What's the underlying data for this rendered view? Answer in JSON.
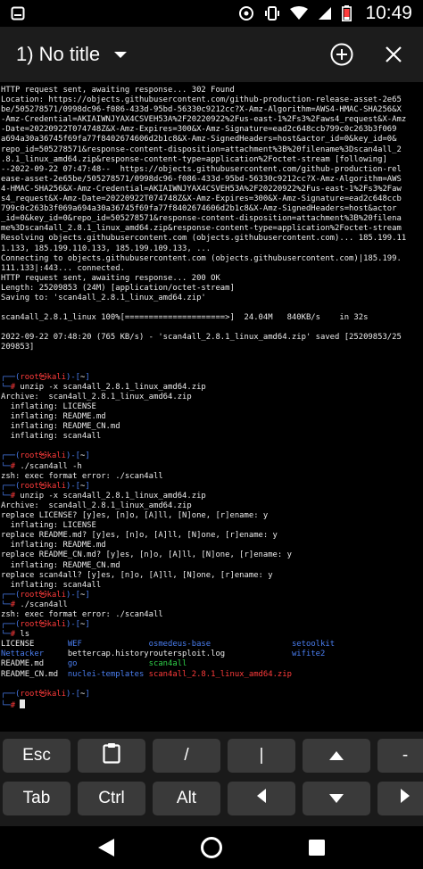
{
  "statusbar": {
    "time": "10:49",
    "icons": [
      "notification-box-icon",
      "sync-icon",
      "vibrate-icon",
      "wifi-icon",
      "signal-icon",
      "battery-icon"
    ]
  },
  "actionbar": {
    "title": "1) No title",
    "icons": [
      "dropdown-icon",
      "add-session-icon",
      "close-icon"
    ]
  },
  "colors": {
    "prompt": "#ff3b3b",
    "path": "#4a7ef0",
    "success": "#2fd24a"
  },
  "terminal": {
    "output": [
      "HTTP request sent, awaiting response... 302 Found",
      "Location: https://objects.githubusercontent.com/github-production-release-asset-2e65",
      "be/505278571/0998dc96-f086-433d-95bd-56330c9212cc?X-Amz-Algorithm=AWS4-HMAC-SHA256&X",
      "-Amz-Credential=AKIAIWNJYAX4CSVEH53A%2F20220922%2Fus-east-1%2Fs3%2Faws4_request&X-Amz",
      "-Date=20220922T074748Z&X-Amz-Expires=300&X-Amz-Signature=ead2c648ccb799c0c263b3f069",
      "a694a30a36745f69fa77f8402674606d2b1c8&X-Amz-SignedHeaders=host&actor_id=0&key_id=0&",
      "repo_id=505278571&response-content-disposition=attachment%3B%20filename%3Dscan4all_2",
      ".8.1_linux_amd64.zip&response-content-type=application%2Foctet-stream [following]",
      "--2022-09-22 07:47:48--  https://objects.githubusercontent.com/github-production-rel",
      "ease-asset-2e65be/505278571/0998dc96-f086-433d-95bd-56330c9212cc?X-Amz-Algorithm=AWS",
      "4-HMAC-SHA256&X-Amz-Credential=AKIAIWNJYAX4CSVEH53A%2F20220922%2Fus-east-1%2Fs3%2Faw",
      "s4_request&X-Amz-Date=20220922T074748Z&X-Amz-Expires=300&X-Amz-Signature=ead2c648ccb",
      "799c0c263b3f069a694a30a36745f69fa77f8402674606d2b1c8&X-Amz-SignedHeaders=host&actor",
      "_id=0&key_id=0&repo_id=505278571&response-content-disposition=attachment%3B%20filena",
      "me%3Dscan4all_2.8.1_linux_amd64.zip&response-content-type=application%2Foctet-stream",
      "Resolving objects.githubusercontent.com (objects.githubusercontent.com)... 185.199.11",
      "1.133, 185.199.110.133, 185.199.109.133, ...",
      "Connecting to objects.githubusercontent.com (objects.githubusercontent.com)|185.199.",
      "111.133|:443... connected.",
      "HTTP request sent, awaiting response... 200 OK",
      "Length: 25209853 (24M) [application/octet-stream]",
      "Saving to: 'scan4all_2.8.1_linux_amd64.zip'",
      "",
      "scan4all_2.8.1_linux 100%[=====================>]  24.04M   840KB/s    in 32s",
      "",
      "2022-09-22 07:48:20 (765 KB/s) - 'scan4all_2.8.1_linux_amd64.zip' saved [25209853/25",
      "209853]",
      "",
      ""
    ],
    "prompt_user": "root㉿kali",
    "prompt_dir": "~",
    "blocks": [
      {
        "command": " unzip -x scan4all_2.8.1_linux_amd64.zip",
        "output": [
          "Archive:  scan4all_2.8.1_linux_amd64.zip",
          "  inflating: LICENSE",
          "  inflating: README.md",
          "  inflating: README_CN.md",
          "  inflating: scan4all",
          ""
        ]
      },
      {
        "command": " ./scan4all -h",
        "output": [
          "zsh: exec format error: ./scan4all"
        ]
      },
      {
        "command": " unzip -x scan4all_2.8.1_linux_amd64.zip",
        "output": [
          "Archive:  scan4all_2.8.1_linux_amd64.zip",
          "replace LICENSE? [y]es, [n]o, [A]ll, [N]one, [r]ename: y",
          "  inflating: LICENSE",
          "replace README.md? [y]es, [n]o, [A]ll, [N]one, [r]ename: y",
          "  inflating: README.md",
          "replace README_CN.md? [y]es, [n]o, [A]ll, [N]one, [r]ename: y",
          "  inflating: README_CN.md",
          "replace scan4all? [y]es, [n]o, [A]ll, [N]one, [r]ename: y",
          "  inflating: scan4all"
        ]
      },
      {
        "command": " ./scan4all",
        "output": [
          "zsh: exec format error: ./scan4all"
        ]
      },
      {
        "command": " ls",
        "output": []
      }
    ],
    "ls_listing": [
      [
        "LICENSE",
        "WEF",
        "osmedeus-base",
        "setoolkit"
      ],
      [
        "Nettacker",
        "bettercap.history",
        "routersploit.log",
        "wifite2"
      ],
      [
        "README.md",
        "go",
        "scan4all",
        ""
      ],
      [
        "README_CN.md",
        "nuclei-templates",
        "scan4all_2.8.1_linux_amd64.zip",
        ""
      ]
    ]
  },
  "extra_keys": {
    "row1": [
      "Esc",
      "clipboard-icon",
      "/",
      "|",
      "up-arrow-icon",
      "-"
    ],
    "row2": [
      "Tab",
      "Ctrl",
      "Alt",
      "left-arrow-icon",
      "down-arrow-icon",
      "right-arrow-icon"
    ],
    "labels": {
      "esc": "Esc",
      "slash": "/",
      "pipe": "|",
      "dash": "-",
      "tab": "Tab",
      "ctrl": "Ctrl",
      "alt": "Alt"
    }
  },
  "navbar": {
    "icons": [
      "back-icon",
      "home-icon",
      "recents-icon"
    ]
  }
}
